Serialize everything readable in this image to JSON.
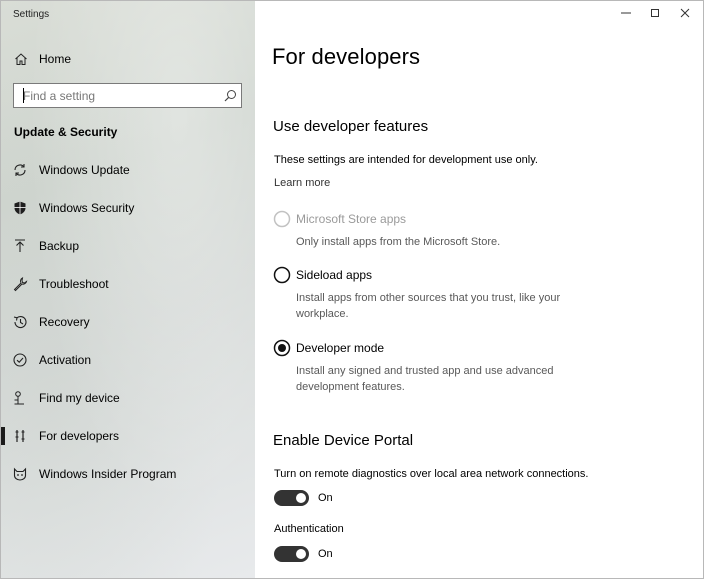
{
  "app": {
    "title": "Settings"
  },
  "sidebar": {
    "home_label": "Home",
    "search_placeholder": "Find a setting",
    "section": "Update & Security",
    "items": [
      {
        "label": "Windows Update",
        "icon": "sync-icon"
      },
      {
        "label": "Windows Security",
        "icon": "shield-icon"
      },
      {
        "label": "Backup",
        "icon": "upload-arrow-icon"
      },
      {
        "label": "Troubleshoot",
        "icon": "wrench-icon"
      },
      {
        "label": "Recovery",
        "icon": "history-icon"
      },
      {
        "label": "Activation",
        "icon": "check-circle-icon"
      },
      {
        "label": "Find my device",
        "icon": "person-pin-icon"
      },
      {
        "label": "For developers",
        "icon": "developer-tools-icon",
        "active": true
      },
      {
        "label": "Windows Insider Program",
        "icon": "cat-icon"
      }
    ]
  },
  "main": {
    "title": "For developers",
    "features": {
      "heading": "Use developer features",
      "intro": "These settings are intended for development use only.",
      "learn_more": "Learn more",
      "options": [
        {
          "label": "Microsoft Store apps",
          "desc": "Only install apps from the Microsoft Store.",
          "state": "disabled"
        },
        {
          "label": "Sideload apps",
          "desc": "Install apps from other sources that you trust, like your workplace.",
          "state": "unselected"
        },
        {
          "label": "Developer mode",
          "desc": "Install any signed and trusted app and use advanced development features.",
          "state": "selected"
        }
      ]
    },
    "portal": {
      "heading": "Enable Device Portal",
      "remote_desc": "Turn on remote diagnostics over local area network connections.",
      "remote_toggle": "On",
      "auth_label": "Authentication",
      "auth_toggle": "On"
    }
  },
  "colors": {
    "accent": "#1b1b1b",
    "toggle_on": "#333333"
  }
}
